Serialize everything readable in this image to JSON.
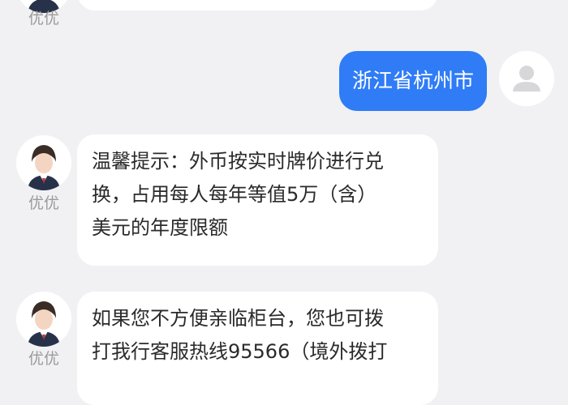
{
  "chat": {
    "agent_name": "优优",
    "user_message": "浙江省杭州市",
    "messages": [
      {
        "lines": [
          "温馨提示：外币按实时牌价进行兑",
          "换，占用每人每年等值5万（含）",
          "美元的年度限额"
        ]
      },
      {
        "lines": [
          "如果您不方便亲临柜台，您也可拨",
          "打我行客服热线95566（境外拨打"
        ]
      }
    ]
  },
  "colors": {
    "background": "#f1f1f3",
    "user_bubble": "#2f7cf6",
    "agent_bubble": "#ffffff",
    "name_text": "#9a9a9a"
  },
  "icons": {
    "user_avatar": "person-silhouette-icon",
    "agent_avatar": "agent-portrait-icon"
  }
}
